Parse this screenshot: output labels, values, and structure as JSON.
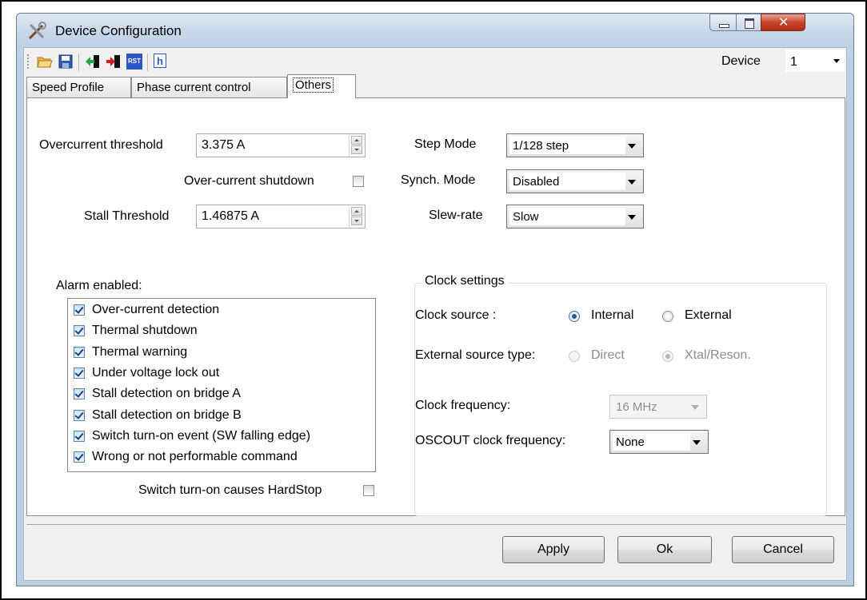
{
  "window": {
    "title": "Device Configuration"
  },
  "toolbar": {
    "icons": [
      "open-folder-icon",
      "save-icon",
      "import-icon",
      "export-icon",
      "reset-icon",
      "header-file-icon"
    ],
    "reset_icon_text": "RST",
    "header_icon_text": "h",
    "device_label": "Device",
    "device_value": "1"
  },
  "tabs": [
    {
      "label": "Speed Profile",
      "selected": false
    },
    {
      "label": "Phase current control",
      "selected": false
    },
    {
      "label": "Others",
      "selected": true
    }
  ],
  "left": {
    "overcurrent_threshold": {
      "label": "Overcurrent threshold",
      "value": "3.375 A"
    },
    "overcurrent_shutdown": {
      "label": "Over-current shutdown",
      "checked": false
    },
    "stall_threshold": {
      "label": "Stall Threshold",
      "value": "1.46875 A"
    },
    "alarm_title": "Alarm enabled:",
    "alarms": [
      {
        "label": "Over-current detection",
        "checked": true
      },
      {
        "label": "Thermal shutdown",
        "checked": true
      },
      {
        "label": "Thermal warning",
        "checked": true
      },
      {
        "label": "Under voltage lock out",
        "checked": true
      },
      {
        "label": "Stall detection on bridge A",
        "checked": true
      },
      {
        "label": "Stall detection on bridge B",
        "checked": true
      },
      {
        "label": "Switch turn-on event (SW falling edge)",
        "checked": true
      },
      {
        "label": "Wrong or not performable command",
        "checked": true
      }
    ],
    "hardstop": {
      "label": "Switch turn-on causes HardStop",
      "checked": false
    }
  },
  "right": {
    "step_mode": {
      "label": "Step Mode",
      "value": "1/128 step"
    },
    "synch_mode": {
      "label": "Synch. Mode",
      "value": "Disabled"
    },
    "slew_rate": {
      "label": "Slew-rate",
      "value": "Slow"
    },
    "clock": {
      "title": "Clock settings",
      "source_label": "Clock source :",
      "source_options": [
        {
          "label": "Internal",
          "selected": true
        },
        {
          "label": "External",
          "selected": false
        }
      ],
      "ext_type_label": "External source type:",
      "ext_type_options": [
        {
          "label": "Direct",
          "selected": false
        },
        {
          "label": "Xtal/Reson.",
          "selected": true
        }
      ],
      "freq_label": "Clock frequency:",
      "freq_value": "16 MHz",
      "oscout_label": "OSCOUT clock frequency:",
      "oscout_value": "None"
    }
  },
  "buttons": {
    "apply": "Apply",
    "ok": "Ok",
    "cancel": "Cancel"
  }
}
